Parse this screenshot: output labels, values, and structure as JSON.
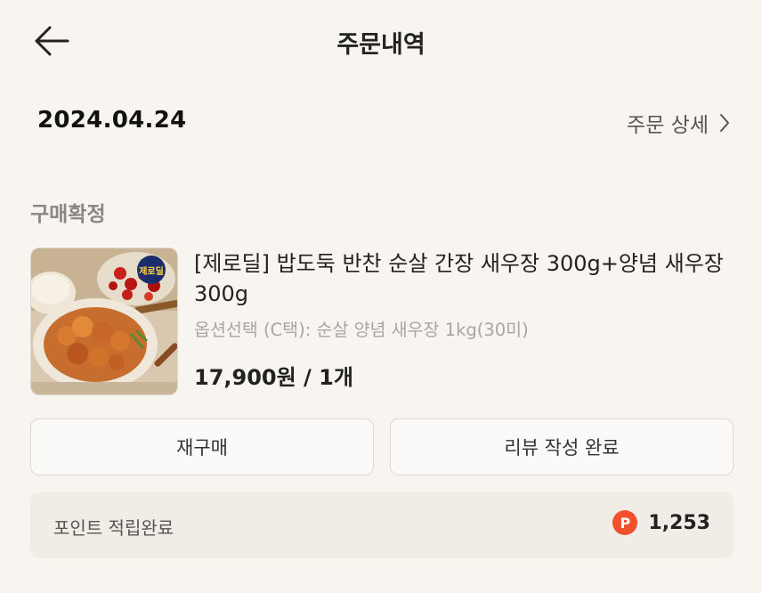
{
  "header": {
    "title": "주문내역",
    "back_icon": "arrow-left-icon"
  },
  "order": {
    "date": "2024.04.24",
    "detail_link": "주문 상세",
    "status": "구매확정",
    "product": {
      "name": "[제로딜] 밥도둑 반찬 순살 간장 새우장 300g+양념 새우장 300g",
      "option": "옵션선택 (C택): 순살 양념 새우장 1kg(30미)",
      "price": "17,900원 / 1개",
      "thumbnail_badge": "제로딜"
    }
  },
  "actions": {
    "rebuy_label": "재구매",
    "review_label": "리뷰 작성 완료"
  },
  "points": {
    "label": "포인트 적립완료",
    "icon_letter": "P",
    "value": "1,253",
    "icon_color": "#f2502d"
  }
}
